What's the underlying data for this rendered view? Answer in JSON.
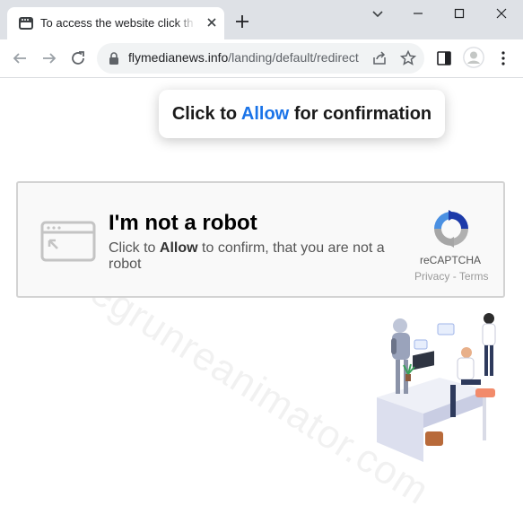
{
  "tab": {
    "title": "To access the website click the \"Allow\" button"
  },
  "address_bar": {
    "host": "flymedianews.info",
    "path": "/landing/default/redirect"
  },
  "watermark": {
    "text": "regrunreanimator.com"
  },
  "confirm_banner": {
    "prefix": "Click to",
    "highlight": "Allow",
    "suffix": "for confirmation",
    "highlight_color": "#1a73e8"
  },
  "captcha": {
    "title": "I'm not a robot",
    "subtitle_prefix": "Click to",
    "subtitle_bold": "Allow",
    "subtitle_suffix": "to confirm, that you are not a robot",
    "brand": "reCAPTCHA",
    "privacy_link": "Privacy",
    "separator": "-",
    "terms_link": "Terms"
  },
  "icons": {
    "favicon": "browser-window-icon",
    "back": "arrow-left-icon",
    "forward": "arrow-right-icon",
    "reload": "reload-icon",
    "lock": "lock-icon",
    "share": "share-icon",
    "bookmark": "star-icon",
    "side_panel": "side-panel-icon",
    "profile": "avatar-icon",
    "menu": "kebab-menu-icon"
  },
  "colors": {
    "chrome_frame": "#dee1e6",
    "accent": "#1a73e8",
    "recaptcha_blue": "#1c3aa9",
    "recaptcha_light_blue": "#4a90e2"
  }
}
